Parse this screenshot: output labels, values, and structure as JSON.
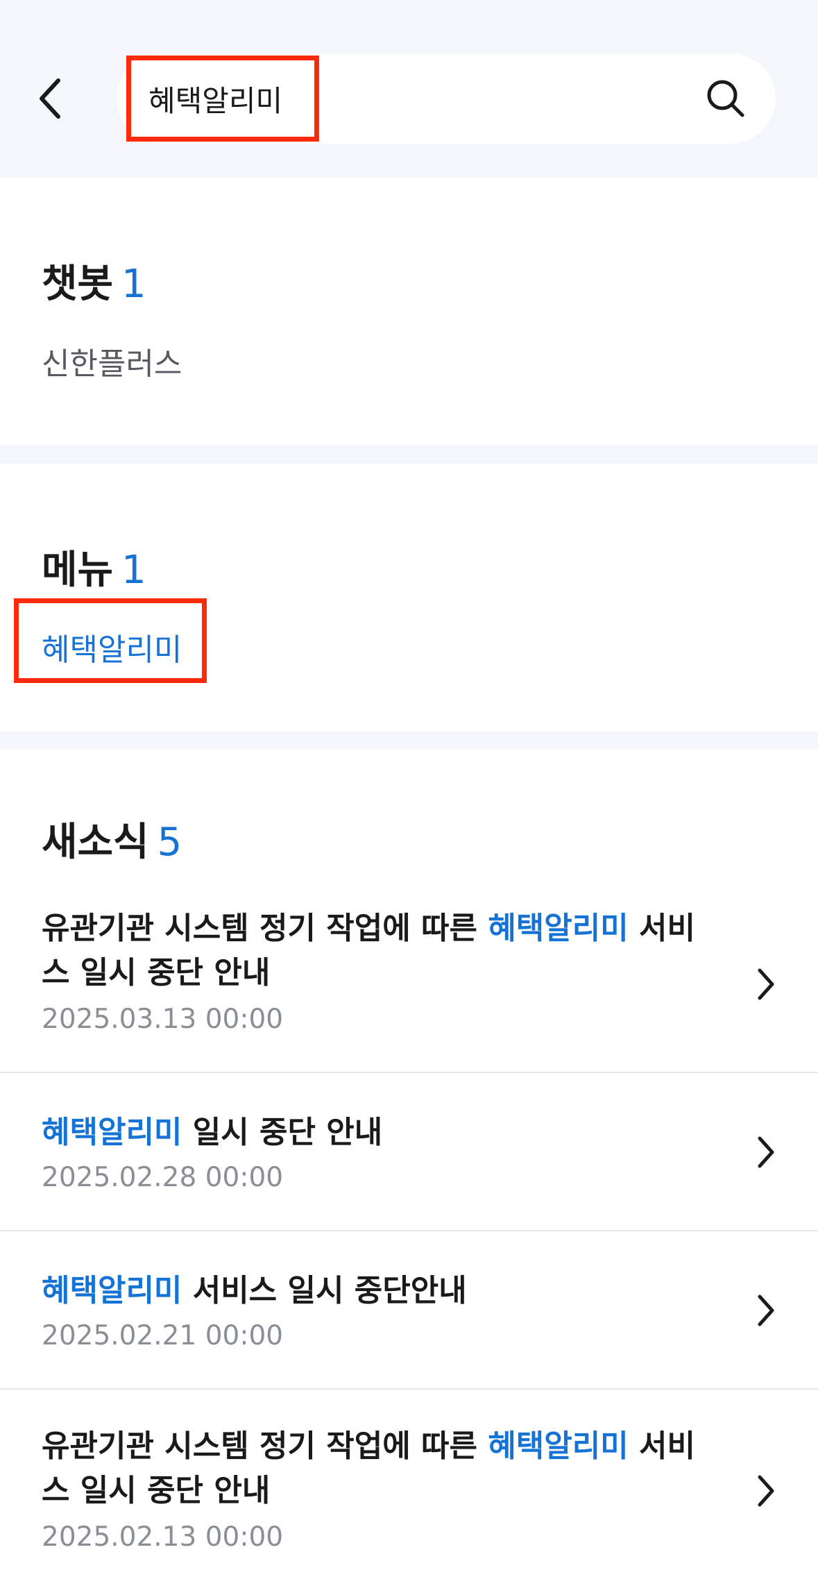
{
  "search": {
    "query": "혜택알리미"
  },
  "chatbot": {
    "title": "챗봇",
    "count": "1",
    "items": [
      "신한플러스"
    ]
  },
  "menu": {
    "title": "메뉴",
    "count": "1",
    "items": [
      "혜택알리미"
    ]
  },
  "news": {
    "title": "새소식",
    "count": "5",
    "items": [
      {
        "pre": "유관기관 시스템 정기 작업에 따른 ",
        "keyword": "혜택알리미",
        "post": " 서비스 일시 중단 안내",
        "date": "2025.03.13 00:00"
      },
      {
        "pre": "",
        "keyword": "혜택알리미",
        "post": " 일시 중단 안내",
        "date": "2025.02.28 00:00"
      },
      {
        "pre": "",
        "keyword": "혜택알리미",
        "post": " 서비스 일시 중단안내",
        "date": "2025.02.21 00:00"
      },
      {
        "pre": "유관기관 시스템 정기 작업에 따른 ",
        "keyword": "혜택알리미",
        "post": " 서비스 일시 중단 안내",
        "date": "2025.02.13 00:00"
      }
    ]
  },
  "colors": {
    "accent": "#1673d6",
    "highlight_box": "#ff2a0a",
    "header_bg": "#f3f6fa"
  },
  "icons": {
    "back": "chevron-left-icon",
    "search": "search-icon",
    "row": "chevron-right-icon"
  }
}
